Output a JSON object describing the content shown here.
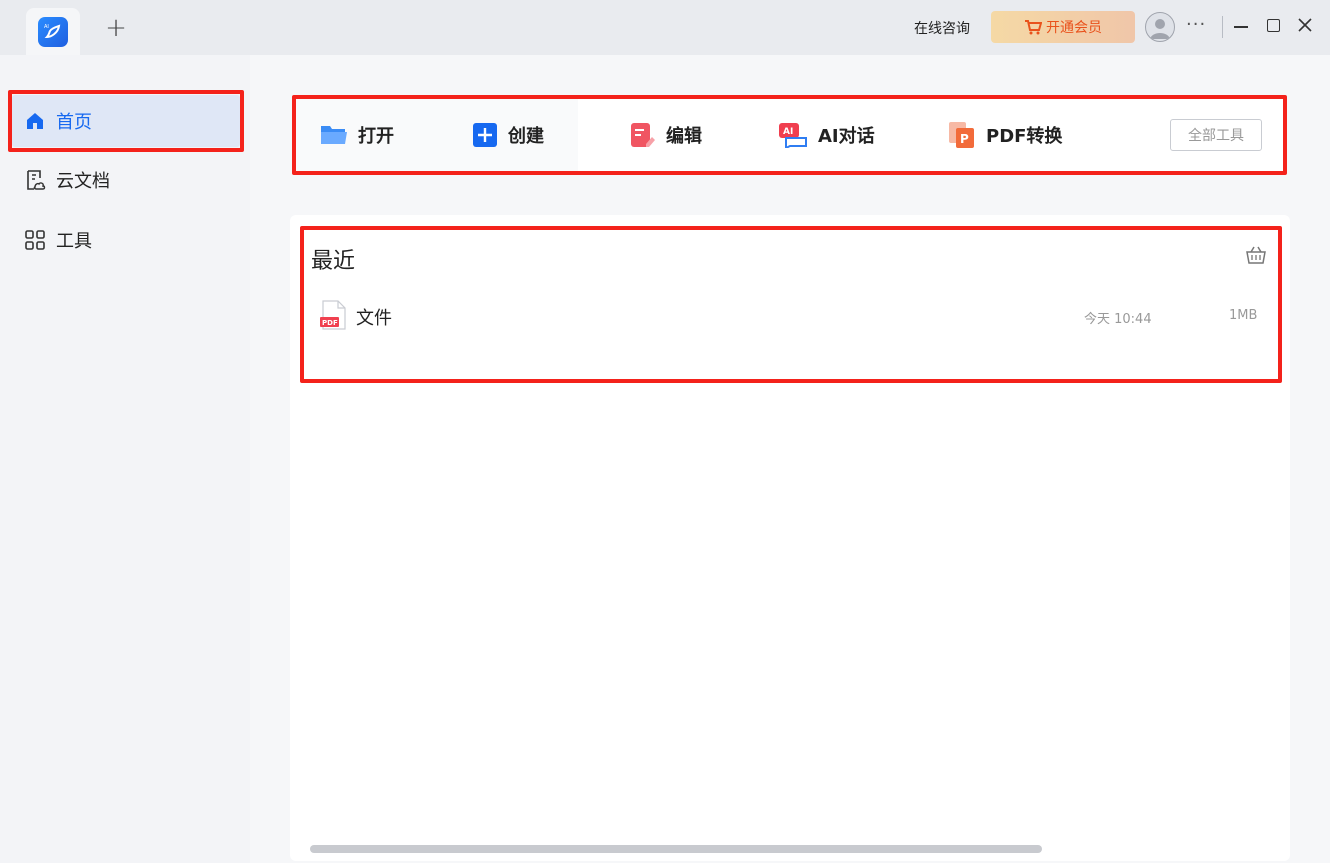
{
  "titlebar": {
    "new_tab_symbol": "+",
    "consult_label": "在线咨询",
    "vip_label": "开通会员",
    "more_symbol": "···"
  },
  "sidebar": {
    "items": [
      {
        "label": "首页",
        "icon": "home-icon",
        "active": true
      },
      {
        "label": "云文档",
        "icon": "cloud-doc-icon",
        "active": false
      },
      {
        "label": "工具",
        "icon": "tools-grid-icon",
        "active": false
      }
    ]
  },
  "toolbar": {
    "open_label": "打开",
    "create_label": "创建",
    "edit_label": "编辑",
    "ai_label": "AI对话",
    "convert_label": "PDF转换",
    "all_tools_label": "全部工具"
  },
  "recent": {
    "title": "最近",
    "files": [
      {
        "name": "文件",
        "type": "PDF",
        "time": "今天 10:44",
        "size": "1MB"
      }
    ]
  },
  "colors": {
    "accent": "#1769f0",
    "highlight": "#f4221b",
    "vip_text": "#e9521c"
  }
}
